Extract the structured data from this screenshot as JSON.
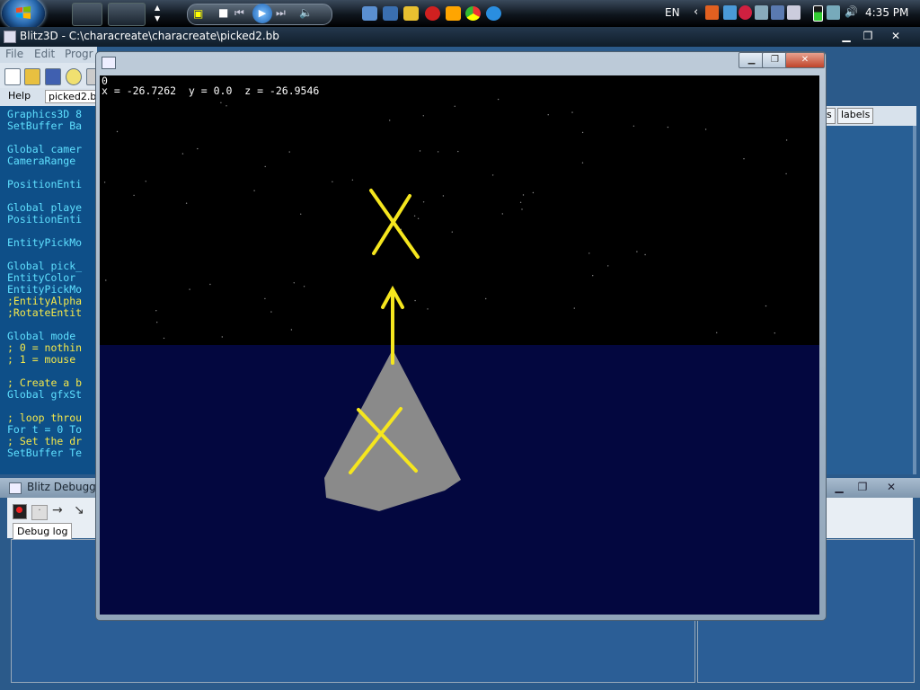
{
  "taskbar": {
    "language": "EN",
    "clock": "4:35 PM"
  },
  "ide": {
    "title": "Blitz3D - C:\\characreate\\characreate\\picked2.bb",
    "menu": [
      "File",
      "Edit",
      "Progr"
    ],
    "tabs": [
      "Help",
      "picked2.b"
    ],
    "right_tabs": [
      "s",
      "labels"
    ],
    "code_lines": [
      {
        "text": "Graphics3D 8",
        "kind": "cmd"
      },
      {
        "text": "SetBuffer Ba",
        "kind": "cmd"
      },
      {
        "text": "",
        "kind": "cmd"
      },
      {
        "text": "Global camer",
        "kind": "cmd"
      },
      {
        "text": "CameraRange ",
        "kind": "cmd"
      },
      {
        "text": "",
        "kind": "cmd"
      },
      {
        "text": "PositionEnti",
        "kind": "cmd"
      },
      {
        "text": "",
        "kind": "cmd"
      },
      {
        "text": "Global playe",
        "kind": "cmd"
      },
      {
        "text": "PositionEnti",
        "kind": "cmd"
      },
      {
        "text": "",
        "kind": "cmd"
      },
      {
        "text": "EntityPickMo",
        "kind": "cmd"
      },
      {
        "text": "",
        "kind": "cmd"
      },
      {
        "text": "Global pick_",
        "kind": "cmd"
      },
      {
        "text": "EntityColor ",
        "kind": "cmd"
      },
      {
        "text": "EntityPickMo",
        "kind": "cmd"
      },
      {
        "text": ";EntityAlpha",
        "kind": "cmt"
      },
      {
        "text": ";RotateEntit",
        "kind": "cmt"
      },
      {
        "text": "",
        "kind": "cmd"
      },
      {
        "text": "Global mode ",
        "kind": "cmd"
      },
      {
        "text": "; 0 = nothin",
        "kind": "cmt"
      },
      {
        "text": "; 1 = mouse ",
        "kind": "cmt"
      },
      {
        "text": "",
        "kind": "cmd"
      },
      {
        "text": "; Create a b",
        "kind": "cmt"
      },
      {
        "text": "Global gfxSt",
        "kind": "cmd"
      },
      {
        "text": "",
        "kind": "cmd"
      },
      {
        "text": "; loop throu",
        "kind": "cmt"
      },
      {
        "text": "For t = 0 To",
        "kind": "cmd"
      },
      {
        "text": "; Set the dr",
        "kind": "cmt"
      },
      {
        "text": "SetBuffer Te",
        "kind": "cmd"
      }
    ]
  },
  "debugger": {
    "title": "Blitz Debugge",
    "tab": "Debug log"
  },
  "game": {
    "readout_line1": "0",
    "readout_line2": "x = -26.7262  y = 0.0  z = -26.9546"
  },
  "colors": {
    "sky": "#000000",
    "ground": "#03073f",
    "marker": "#f5e61e",
    "cone": "#8a8a8a",
    "code_command": "#5fe0ff",
    "code_comment": "#f5e84a"
  }
}
